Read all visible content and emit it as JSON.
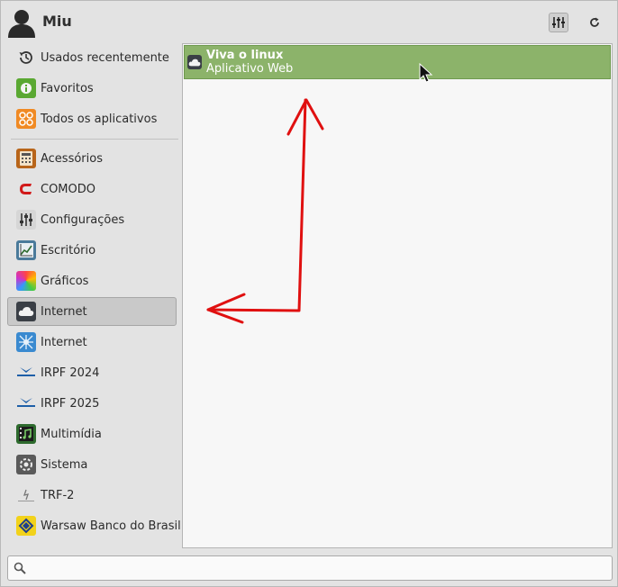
{
  "header": {
    "user_name": "Miu",
    "settings_icon": "settings-sliders-icon",
    "refresh_icon": "refresh-icon"
  },
  "sidebar": {
    "items": [
      {
        "label": "Usados recentemente",
        "icon": "recent-history-icon",
        "color": "#ffffff"
      },
      {
        "label": "Favoritos",
        "icon": "favorites-info-icon",
        "color": "#5aa832"
      },
      {
        "label": "Todos os aplicativos",
        "icon": "all-apps-icon",
        "color": "#f08a24"
      },
      {
        "label": "Acessórios",
        "icon": "accessories-calculator-icon",
        "color": "#b8651a"
      },
      {
        "label": "COMODO",
        "icon": "comodo-icon",
        "color": "#d11a1a"
      },
      {
        "label": "Configurações",
        "icon": "settings-icon",
        "color": "#8a8a8a"
      },
      {
        "label": "Escritório",
        "icon": "office-chart-icon",
        "color": "#4a7a9a"
      },
      {
        "label": "Gráficos",
        "icon": "graphics-icon",
        "color": "#e05a9a"
      },
      {
        "label": "Internet",
        "icon": "cloud-icon",
        "color": "#3a3f46"
      },
      {
        "label": "Internet",
        "icon": "internet-network-icon",
        "color": "#3a8ad0"
      },
      {
        "label": "IRPF 2024",
        "icon": "receita-federal-icon",
        "color": "#1e5fa8"
      },
      {
        "label": "IRPF 2025",
        "icon": "receita-federal-icon",
        "color": "#1e5fa8"
      },
      {
        "label": "Multimídia",
        "icon": "multimedia-icon",
        "color": "#2e6b2e"
      },
      {
        "label": "Sistema",
        "icon": "system-icon",
        "color": "#5a5a5a"
      },
      {
        "label": "TRF-2",
        "icon": "trf2-icon",
        "color": "#888888"
      },
      {
        "label": "Warsaw Banco do Brasil",
        "icon": "banco-do-brasil-icon",
        "color": "#f2d21b"
      }
    ],
    "selected_index": 8
  },
  "apps": {
    "items": [
      {
        "name": "Viva o linux",
        "description": "Aplicativo Web",
        "icon": "cloud-icon"
      }
    ],
    "highlight_color": "#8cb36a"
  },
  "search": {
    "value": "",
    "placeholder": "",
    "icon": "search-icon"
  },
  "annotation": {
    "color": "#e01010"
  }
}
